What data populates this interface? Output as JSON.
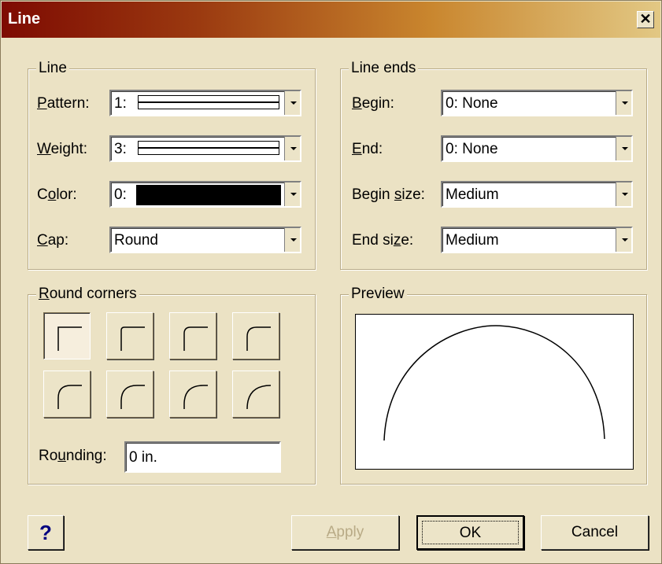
{
  "window": {
    "title": "Line",
    "close_glyph": "✕"
  },
  "line_group": {
    "legend": "Line",
    "pattern": {
      "label_u": "P",
      "label_rest": "attern:",
      "value": "1:"
    },
    "weight": {
      "label_u": "W",
      "label_rest": "eight:",
      "value": "3:"
    },
    "color": {
      "label_pre": "C",
      "label_u": "o",
      "label_rest": "lor:",
      "value": "0:",
      "swatch": "#000000"
    },
    "cap": {
      "label_u": "C",
      "label_rest": "ap:",
      "value": "Round"
    }
  },
  "line_ends_group": {
    "legend": "Line ends",
    "begin": {
      "label_u": "B",
      "label_rest": "egin:",
      "value": "0: None"
    },
    "end": {
      "label_u": "E",
      "label_rest": "nd:",
      "value": "0: None"
    },
    "begin_size": {
      "label_pre": "Begin ",
      "label_u": "s",
      "label_rest": "ize:",
      "value": "Medium"
    },
    "end_size": {
      "label_pre": "End si",
      "label_u": "z",
      "label_rest": "e:",
      "value": "Medium"
    }
  },
  "round_corners_group": {
    "legend_u": "R",
    "legend_rest": "ound corners",
    "corner_icons": [
      "square-corner-icon",
      "round-corner-1-icon",
      "round-corner-2-icon",
      "round-corner-3-icon",
      "round-corner-4-icon",
      "round-corner-5-icon",
      "round-corner-6-icon",
      "round-corner-7-icon"
    ],
    "rounding": {
      "label_pre": "Ro",
      "label_u": "u",
      "label_rest": "nding:",
      "value": "0 in."
    }
  },
  "preview_group": {
    "legend": "Preview"
  },
  "buttons": {
    "help": "?",
    "apply_u": "A",
    "apply_rest": "pply",
    "ok": "OK",
    "cancel": "Cancel"
  }
}
